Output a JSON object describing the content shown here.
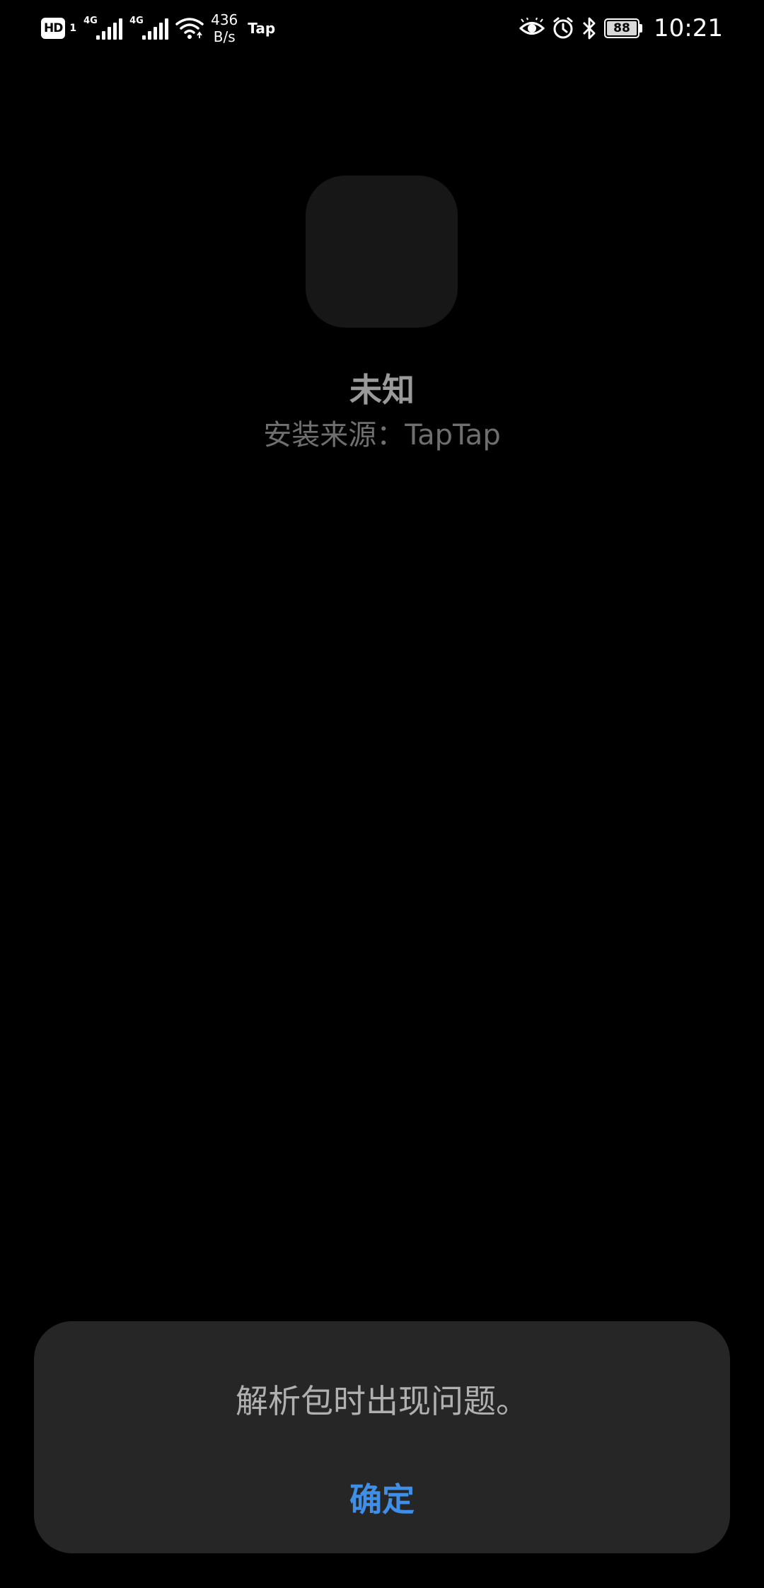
{
  "status_bar": {
    "hd_label": "HD",
    "sim_number": "1",
    "network_type_1": "4G",
    "network_type_2": "4G",
    "speed_value": "436",
    "speed_unit": "B/s",
    "app_notification": "Tap",
    "battery_level": "88",
    "time": "10:21",
    "icons": [
      "eye-icon",
      "alarm-icon",
      "bluetooth-icon",
      "wifi-icon",
      "signal-icon"
    ]
  },
  "app": {
    "name": "未知",
    "source": "安装来源：TapTap"
  },
  "dialog": {
    "message": "解析包时出现问题。",
    "confirm_label": "确定"
  },
  "colors": {
    "background": "#000000",
    "dialog_background": "#262626",
    "accent": "#3f8ee8"
  }
}
